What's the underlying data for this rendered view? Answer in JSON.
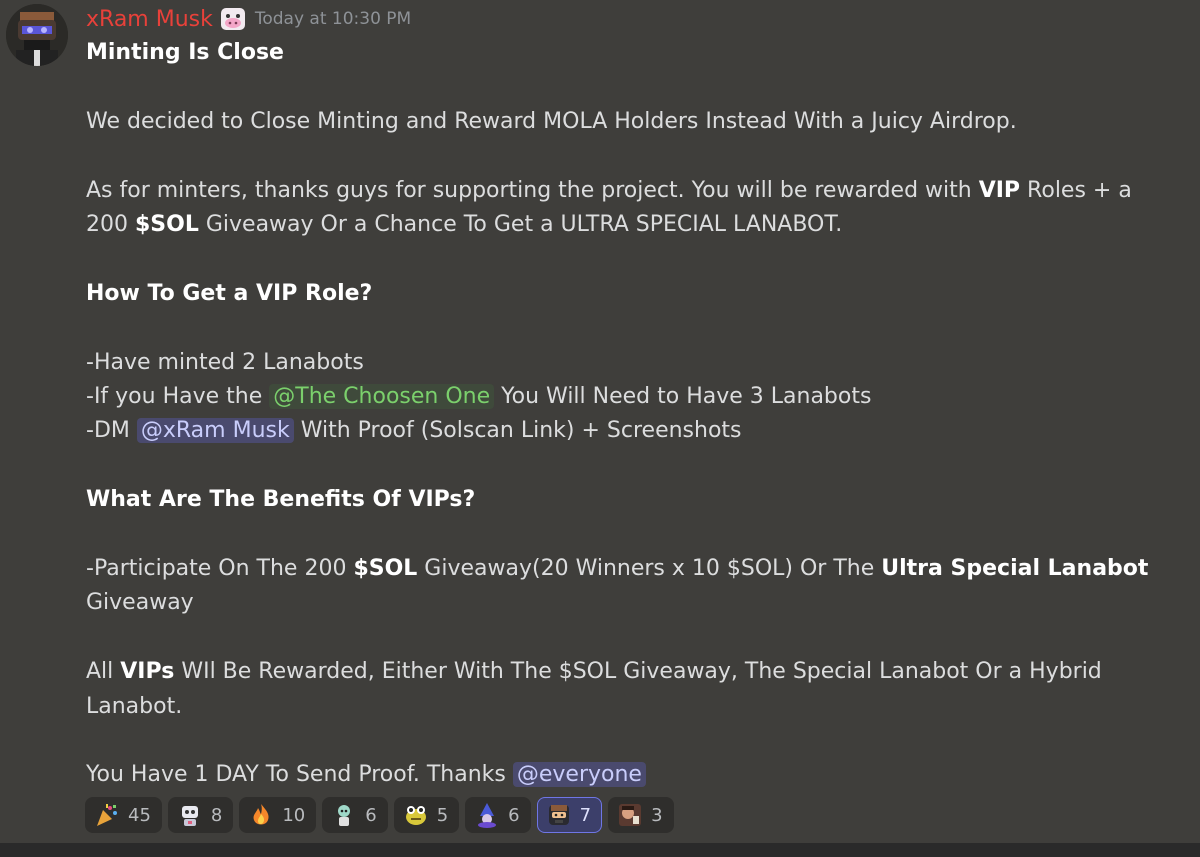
{
  "author": {
    "name": "xRam Musk",
    "badge_icon": "cow-face-icon",
    "timestamp": "Today at 10:30 PM",
    "color": "#e8413a"
  },
  "message": {
    "title": "Minting Is Close",
    "p1": "We decided to Close Minting and Reward MOLA Holders Instead With a Juicy Airdrop.",
    "p2_a": "As for minters, thanks guys for supporting the project. You will be rewarded with ",
    "p2_b": "VIP",
    "p2_c": " Roles + a 200 ",
    "p2_d": "$SOL",
    "p2_e": " Giveaway Or a Chance To Get a ULTRA SPECIAL LANABOT.",
    "h1": "How To Get a VIP Role?",
    "l1": "-Have minted 2 Lanabots",
    "l2_a": "-If you Have the ",
    "l2_mention": "@The Choosen One",
    "l2_b": " You Will Need to Have 3 Lanabots",
    "l3_a": "-DM ",
    "l3_mention": "@xRam Musk",
    "l3_b": " With Proof (Solscan Link) + Screenshots",
    "h2": "What Are The Benefits Of VIPs?",
    "b1_a": "-Participate On The 200 ",
    "b1_b": "$SOL",
    "b1_c": " Giveaway(20 Winners x 10 $SOL) Or The ",
    "b1_d": "Ultra Special Lanabot",
    "b1_e": " Giveaway",
    "p3_a": "All ",
    "p3_b": "VIPs",
    "p3_c": " WIl Be Rewarded, Either With The $SOL Giveaway, The Special Lanabot Or a Hybrid Lanabot.",
    "p4_a": "You Have 1 DAY To Send Proof. Thanks ",
    "p4_mention": "@everyone"
  },
  "reactions": [
    {
      "icon": "party-popper-icon",
      "count": "45"
    },
    {
      "icon": "robot-emoji-icon",
      "count": "8"
    },
    {
      "icon": "fire-icon",
      "count": "10"
    },
    {
      "icon": "character-emoji-icon",
      "count": "6"
    },
    {
      "icon": "frog-emoji-icon",
      "count": "5"
    },
    {
      "icon": "wizard-emoji-icon",
      "count": "6"
    },
    {
      "icon": "bot-face-emoji-icon",
      "count": "7",
      "active": true
    },
    {
      "icon": "person-emoji-icon",
      "count": "3"
    }
  ],
  "colors": {
    "background": "#3f3e3b",
    "mention_bg": "#4a4a6e",
    "role_mention_text": "#7bd06c",
    "active_reaction_border": "#6f76e6"
  }
}
